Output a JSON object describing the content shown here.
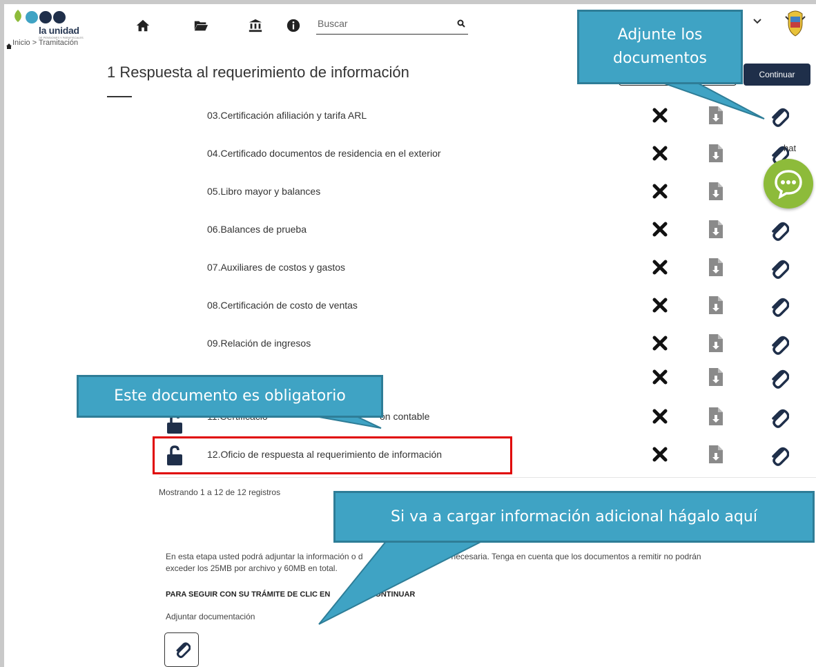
{
  "header": {
    "logo_text": "la unidad",
    "logo_sub": "DE PENSIONES Y PARAFISCALES",
    "search_placeholder": "Buscar"
  },
  "breadcrumb": "Inicio > Tramitación",
  "page": {
    "title": "1 Respuesta al requerimiento de información",
    "continue_label": "Continuar"
  },
  "documents": [
    {
      "label": "03.Certificación afiliación y tarifa ARL"
    },
    {
      "label": "04.Certificado documentos de residencia en el exterior"
    },
    {
      "label": "05.Libro mayor y balances"
    },
    {
      "label": "06.Balances de prueba"
    },
    {
      "label": "07.Auxiliares de costos y gastos"
    },
    {
      "label": "08.Certificación de costo de ventas"
    },
    {
      "label": "09.Relación de ingresos"
    },
    {
      "label": ""
    },
    {
      "label": "11.Certificació"
    },
    {
      "label": "12.Oficio de respuesta al requerimiento de información"
    }
  ],
  "row11_tail": "ón contable",
  "records_text": "Mostrando 1 a 12 de 12 registros",
  "info_text_1": "En esta etapa usted podrá adjuntar la información o d",
  "info_text_2": "me necesaria. Tenga en cuenta que los documentos a remitir no podrán",
  "info_text_3": "exceder los 25MB por archivo y 60MB en total.",
  "instruction_1": "PARA SEGUIR CON SU TRÁMITE DE CLIC EN",
  "instruction_2": "N CONTINUAR",
  "attach_label": "Adjuntar documentación",
  "chat_label": "hat",
  "callouts": {
    "attach_docs": "Adjunte los documentos",
    "mandatory": "Este documento es obligatorio",
    "additional": "Si va a cargar información adicional hágalo aquí"
  },
  "colors": {
    "callout_fill": "#3fa3c4",
    "highlight_border": "#e00000",
    "continue_bg": "#1f2f4a",
    "chat_green": "#8dbb3a"
  }
}
